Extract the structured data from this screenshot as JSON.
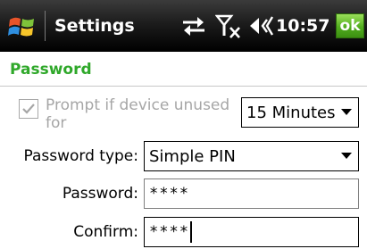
{
  "titlebar": {
    "app_title": "Settings",
    "clock": "10:57",
    "ok_label": "ok",
    "icons": [
      "windows-start-icon",
      "connectivity-icon",
      "signal-off-icon",
      "volume-icon"
    ]
  },
  "page": {
    "heading": "Password",
    "heading_color": "#2fa82a"
  },
  "prompt": {
    "label": "Prompt if device unused for",
    "checked": true,
    "enabled": false,
    "timeout_selected": "15 Minutes"
  },
  "form": {
    "password_type_label": "Password type:",
    "password_type_selected": "Simple PIN",
    "password_label": "Password:",
    "password_value": "****",
    "confirm_label": "Confirm:",
    "confirm_value": "****"
  }
}
